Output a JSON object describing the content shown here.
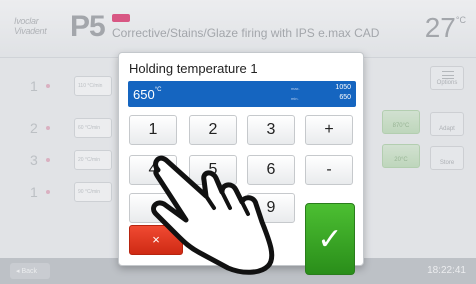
{
  "header": {
    "logo": "Ivoclar Vivadent",
    "program": "P5",
    "badge": "",
    "program_title": "Corrective/Stains/Glaze firing with IPS e.max CAD",
    "temperature": "27",
    "temperature_unit": "°C"
  },
  "rows": [
    {
      "num": "1",
      "field": "110 °C/min"
    },
    {
      "num": "2",
      "field": "60 °C/min"
    },
    {
      "num": "3",
      "field": "20 °C/min"
    },
    {
      "num": "1",
      "field": "90 °C/min"
    }
  ],
  "side_buttons": {
    "options": "Options",
    "adapt": "Adapt",
    "store": "Store",
    "green_a": "870°C",
    "green_b": "20°C"
  },
  "footer": {
    "back": "Back",
    "clock": "18:22:41"
  },
  "dialog": {
    "title": "Holding temperature 1",
    "value": "650",
    "unit": "°C",
    "max_label": "max.",
    "max_value": "1050",
    "min_label": "min.",
    "min_value": "650",
    "keys": [
      "1",
      "2",
      "3",
      "+",
      "4",
      "5",
      "6",
      "-",
      "9"
    ],
    "cancel": "×",
    "ok": "✓"
  },
  "colors": {
    "value_bar": "#1565c0",
    "ok_button": "#3aa82a",
    "cancel_button": "#e23a22"
  }
}
